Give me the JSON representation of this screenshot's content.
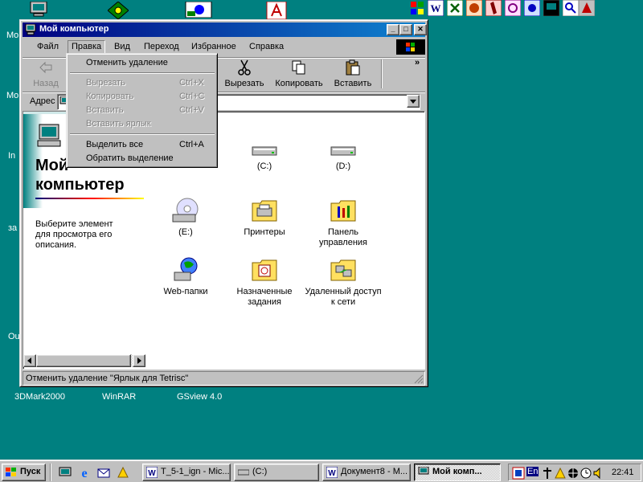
{
  "desktop": {
    "labels": [
      {
        "key": "mo1",
        "text": "Mo"
      },
      {
        "key": "mo2",
        "text": "Mo"
      },
      {
        "key": "in",
        "text": "In"
      },
      {
        "key": "za",
        "text": "за"
      },
      {
        "key": "ou",
        "text": "Ou"
      },
      {
        "key": "dmark",
        "text": "3DMark2000"
      },
      {
        "key": "winrar",
        "text": "WinRAR"
      },
      {
        "key": "gsview",
        "text": "GSview 4.0"
      }
    ]
  },
  "window": {
    "title": "Мой компьютер",
    "menu": [
      "Файл",
      "Правка",
      "Вид",
      "Переход",
      "Избранное",
      "Справка"
    ],
    "toolbar": {
      "back": "Назад",
      "cut": "Вырезать",
      "copy": "Копировать",
      "paste": "Вставить",
      "more": "»"
    },
    "address_label": "Адрес",
    "left_pane": {
      "title_line1": "Мой",
      "title_line2": "компьютер",
      "description": "Выберите элемент для просмотра его описания."
    },
    "items": [
      {
        "label": "(C:)",
        "icon": "hard-drive-icon"
      },
      {
        "label": "(D:)",
        "icon": "hard-drive-icon"
      },
      {
        "label": "(E:)",
        "icon": "cd-drive-icon"
      },
      {
        "label": "Принтеры",
        "icon": "printers-folder-icon"
      },
      {
        "label": "Панель управления",
        "icon": "control-panel-folder-icon"
      },
      {
        "label": "Web-папки",
        "icon": "web-folders-icon"
      },
      {
        "label": "Назначенные задания",
        "icon": "scheduled-tasks-folder-icon"
      },
      {
        "label": "Удаленный доступ к сети",
        "icon": "dial-up-networking-folder-icon"
      }
    ],
    "status": "Отменить удаление \"Ярлык для Tetrisc\""
  },
  "edit_menu": {
    "items": [
      {
        "label": "Отменить удаление",
        "shortcut": "",
        "disabled": false
      },
      {
        "label": "Вырезать",
        "shortcut": "Ctrl+X",
        "disabled": true
      },
      {
        "label": "Копировать",
        "shortcut": "Ctrl+C",
        "disabled": true
      },
      {
        "label": "Вставить",
        "shortcut": "Ctrl+V",
        "disabled": true
      },
      {
        "label": "Вставить ярлык",
        "shortcut": "",
        "disabled": true
      },
      {
        "label": "Выделить все",
        "shortcut": "Ctrl+A",
        "disabled": false
      },
      {
        "label": "Обратить выделение",
        "shortcut": "",
        "disabled": false
      }
    ]
  },
  "taskbar": {
    "start": "Пуск",
    "tasks": [
      {
        "label": "T_5-1_ign - Mic...",
        "active": false
      },
      {
        "label": "(C:)",
        "active": false
      },
      {
        "label": "Документ8 - M...",
        "active": false
      },
      {
        "label": "Мой комп...",
        "active": true
      }
    ],
    "language": "En",
    "clock": "22:41"
  },
  "colors": {
    "desktop": "#008080",
    "title_start": "#000080",
    "title_end": "#1084d0",
    "face": "#c0c0c0"
  }
}
